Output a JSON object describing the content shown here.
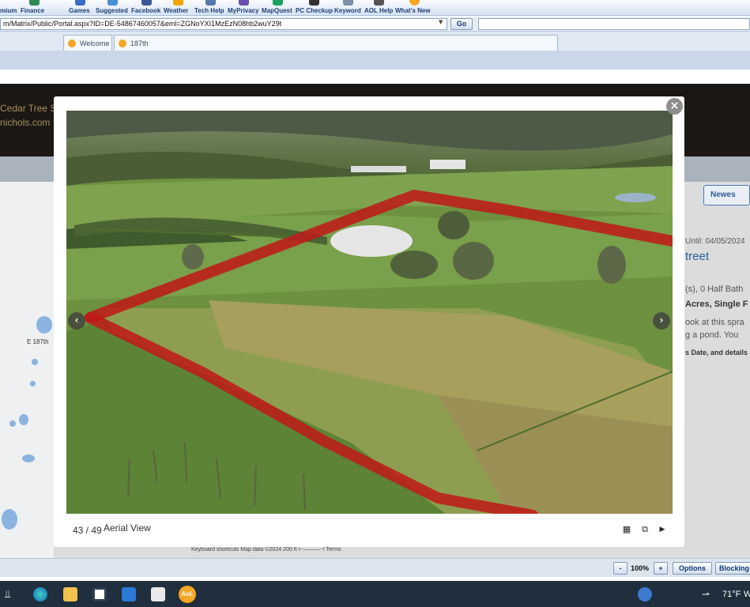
{
  "toolbar": {
    "items": [
      {
        "label": "mium",
        "icon": "premium-icon",
        "color": "#d4a017"
      },
      {
        "label": "Finance",
        "icon": "finance-icon",
        "color": "#2e8b57"
      },
      {
        "label": "Games",
        "icon": "games-icon",
        "color": "#3b6cc6"
      },
      {
        "label": "Suggested",
        "icon": "suggested-icon",
        "color": "#4a90d9"
      },
      {
        "label": "Facebook",
        "icon": "facebook-icon",
        "color": "#3b5998"
      },
      {
        "label": "Weather",
        "icon": "weather-icon",
        "color": "#f0a500"
      },
      {
        "label": "Tech Help",
        "icon": "tech-help-icon",
        "color": "#5577aa"
      },
      {
        "label": "MyPrivacy",
        "icon": "privacy-icon",
        "color": "#6a4fb3"
      },
      {
        "label": "MapQuest",
        "icon": "mapquest-icon",
        "color": "#1aa260"
      },
      {
        "label": "PC Checkup",
        "icon": "pc-checkup-icon",
        "color": "#333333"
      },
      {
        "label": "Keyword",
        "icon": "keyword-icon",
        "color": "#7a8fa8"
      },
      {
        "label": "AOL Help",
        "icon": "aol-help-icon",
        "color": "#555555"
      },
      {
        "label": "What's New",
        "icon": "whats-new-icon",
        "color": "#f5a623"
      }
    ]
  },
  "address": {
    "url": "m/Matrix/Public/Portal.aspx?ID=DE-54867460057&eml=ZGNoYXI1MzEzN08hb2wuY29t",
    "go_label": "Go"
  },
  "tabs": [
    {
      "label": "Welcome"
    },
    {
      "label": "187th"
    }
  ],
  "page": {
    "header_line1": "Cedar Tree S",
    "header_line2": "nichols.com",
    "left_label": "th",
    "newest_label": "Newes",
    "until": "Until: 04/05/2024",
    "street": "treet",
    "bath": "(s), 0 Half Bath",
    "acres": "Acres, Single F",
    "desc1": "ook at this spra",
    "desc2": "g a pond. You",
    "date_line": "s Date, and details",
    "map_road": "E 187th",
    "map_attr": "Keyboard shortcuts    Map data ©2024    200 ft ⊢———⊣    Terms"
  },
  "viewer": {
    "counter": "43 / 49",
    "caption": "Aerial View",
    "close": "×",
    "prev": "‹",
    "next": "›",
    "grid_icon": "▦",
    "expand_icon": "⧉",
    "play_icon": "▶"
  },
  "status": {
    "zoom_out": "-",
    "zoom": "100%",
    "zoom_in": "+",
    "options": "Options",
    "blocking": "Blocking"
  },
  "taskbar": {
    "aol_label": "Aol.",
    "temperature": "71°F",
    "weather_suffix": "W"
  }
}
